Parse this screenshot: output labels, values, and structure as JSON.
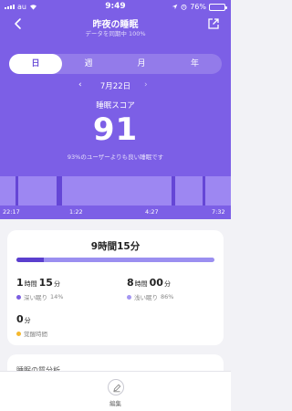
{
  "status_bar": {
    "carrier": "au",
    "time": "9:49",
    "battery": "76%",
    "battery_level": 0.76
  },
  "nav": {
    "title": "昨夜の睡眠",
    "subtitle": "データを同期中 100%"
  },
  "tabs": [
    {
      "label": "日",
      "active": true
    },
    {
      "label": "週",
      "active": false
    },
    {
      "label": "月",
      "active": false
    },
    {
      "label": "年",
      "active": false
    }
  ],
  "date": {
    "label": "7月22日",
    "prev_glyph": "‹",
    "next_glyph": "›"
  },
  "score": {
    "label": "睡眠スコア",
    "value": "91",
    "note": "93%のユーザーよりも良い睡眠です"
  },
  "timeline": {
    "labels": [
      "22:17",
      "1:22",
      "4:27",
      "7:32"
    ],
    "colors": {
      "light": "#9d87f2",
      "deep": "#6546d6"
    }
  },
  "summary": {
    "total": "9時間15分",
    "deep_fraction": 0.14,
    "deep": {
      "hours": "1",
      "h_unit": "時間",
      "minutes": "15",
      "m_unit": "分",
      "label": "深い眠り",
      "percent": "14%",
      "color": "#7b5ee0"
    },
    "light": {
      "hours": "8",
      "h_unit": "時間",
      "minutes": "00",
      "m_unit": "分",
      "label": "浅い眠り",
      "percent": "86%",
      "color": "#a496f2"
    },
    "awake": {
      "minutes": "0",
      "m_unit": "分",
      "label": "覚醒時間",
      "color": "#f5b82e"
    }
  },
  "analysis": {
    "title": "睡眠の質分析"
  },
  "bottom": {
    "edit_label": "編集"
  }
}
